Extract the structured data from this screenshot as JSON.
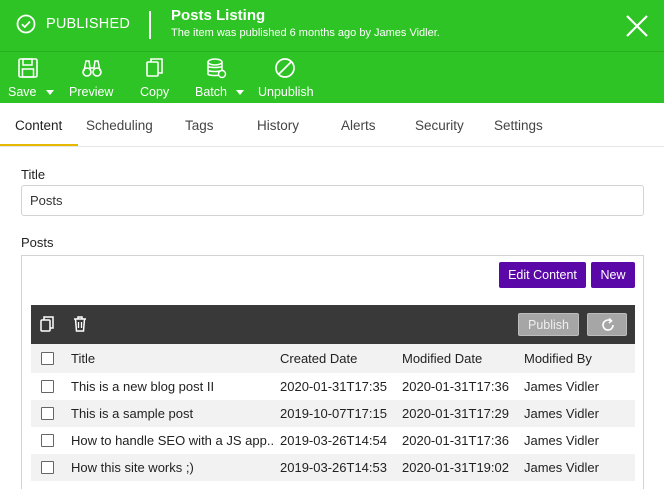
{
  "header": {
    "status": "PUBLISHED",
    "title": "Posts Listing",
    "subtitle": "The item was published 6 months ago by James Vidler.",
    "color": "#2fc425"
  },
  "toolbar": {
    "save": "Save",
    "preview": "Preview",
    "copy": "Copy",
    "batch": "Batch",
    "unpublish": "Unpublish"
  },
  "tabs": [
    "Content",
    "Scheduling",
    "Tags",
    "History",
    "Alerts",
    "Security",
    "Settings"
  ],
  "active_tab": "Content",
  "form": {
    "title_label": "Title",
    "title_value": "Posts",
    "posts_label": "Posts"
  },
  "posts": {
    "edit_content": "Edit Content",
    "new": "New",
    "accent": "#5a08a8",
    "publish": "Publish",
    "columns": [
      "Title",
      "Created Date",
      "Modified Date",
      "Modified By"
    ],
    "rows": [
      {
        "title": "This is a new blog post II",
        "created": "2020-01-31T17:35",
        "modified": "2020-01-31T17:36",
        "by": "James Vidler"
      },
      {
        "title": "This is a sample post",
        "created": "2019-10-07T17:15",
        "modified": "2020-01-31T17:29",
        "by": "James Vidler"
      },
      {
        "title": "How to handle SEO with a JS app...",
        "created": "2019-03-26T14:54",
        "modified": "2020-01-31T17:36",
        "by": "James Vidler"
      },
      {
        "title": "How this site works ;)",
        "created": "2019-03-26T14:53",
        "modified": "2020-01-31T19:02",
        "by": "James Vidler"
      }
    ]
  }
}
